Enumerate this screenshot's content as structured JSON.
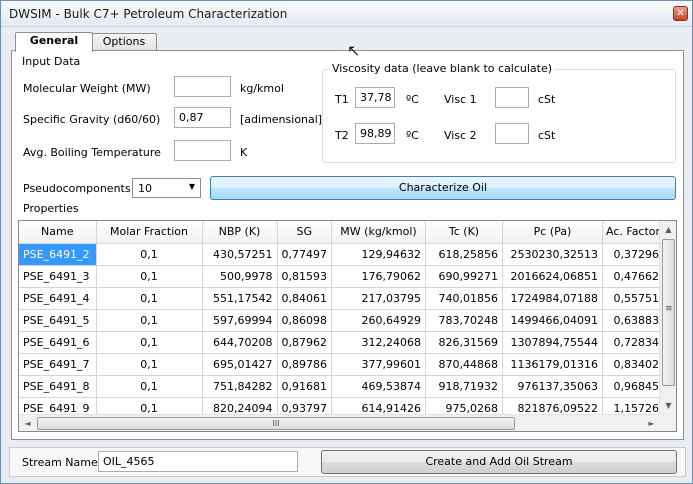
{
  "window": {
    "title": "DWSIM - Bulk C7+ Petroleum Characterization",
    "close_glyph": "✕"
  },
  "tabs": [
    {
      "label": "General"
    },
    {
      "label": "Options"
    }
  ],
  "input_data": {
    "group_label": "Input Data",
    "mw": {
      "label": "Molecular Weight (MW)",
      "value": "",
      "unit": "kg/kmol"
    },
    "sg": {
      "label": "Specific Gravity (d60/60)",
      "value": "0,87",
      "unit": "[adimensional]"
    },
    "abt": {
      "label": "Avg. Boiling Temperature",
      "value": "",
      "unit": "K"
    }
  },
  "viscosity": {
    "group_label": "Viscosity data (leave blank to calculate)",
    "t1": {
      "label": "T1",
      "value": "37,78",
      "unit": "ºC"
    },
    "t2": {
      "label": "T2",
      "value": "98,89",
      "unit": "ºC"
    },
    "visc1": {
      "label": "Visc 1",
      "value": "",
      "unit": "cSt"
    },
    "visc2": {
      "label": "Visc 2",
      "value": "",
      "unit": "cSt"
    }
  },
  "pseudo": {
    "label": "Pseudocomponents",
    "selected": "10",
    "arrow": "▼"
  },
  "characterize_button": "Characterize Oil",
  "properties": {
    "label": "Properties",
    "columns": [
      "Name",
      "Molar Fraction",
      "NBP (K)",
      "SG",
      "MW (kg/kmol)",
      "Tc (K)",
      "Pc (Pa)",
      "Ac. Factor"
    ],
    "rows": [
      [
        "PSE_6491_2",
        "0,1",
        "430,57251",
        "0,77497",
        "129,94632",
        "618,25856",
        "2530230,32513",
        "0,37296"
      ],
      [
        "PSE_6491_3",
        "0,1",
        "500,9978",
        "0,81593",
        "176,79062",
        "690,99271",
        "2016624,06851",
        "0,47662"
      ],
      [
        "PSE_6491_4",
        "0,1",
        "551,17542",
        "0,84061",
        "217,03795",
        "740,01856",
        "1724984,07188",
        "0,55751"
      ],
      [
        "PSE_6491_5",
        "0,1",
        "597,69994",
        "0,86098",
        "260,64929",
        "783,70248",
        "1499466,04091",
        "0,63883"
      ],
      [
        "PSE_6491_6",
        "0,1",
        "644,70208",
        "0,87962",
        "312,24068",
        "826,31569",
        "1307894,75544",
        "0,72834"
      ],
      [
        "PSE_6491_7",
        "0,1",
        "695,01427",
        "0,89786",
        "377,99601",
        "870,44868",
        "1136179,01316",
        "0,83402"
      ],
      [
        "PSE_6491_8",
        "0,1",
        "751,84282",
        "0,91681",
        "469,53874",
        "918,71932",
        "976137,35063",
        "0,96845"
      ],
      [
        "PSE_6491_9",
        "0,1",
        "820,24094",
        "0,93797",
        "614,91426",
        "975,0268",
        "821876,09522",
        "1,15726"
      ]
    ]
  },
  "scroll": {
    "up": "▲",
    "down": "▼",
    "left": "◄",
    "right": "►",
    "grip_v": "≡",
    "grip_h": "III"
  },
  "stream": {
    "label": "Stream Name",
    "value": "OIL_4565"
  },
  "create_button": "Create and Add Oil Stream",
  "cursor_glyph": "↖"
}
